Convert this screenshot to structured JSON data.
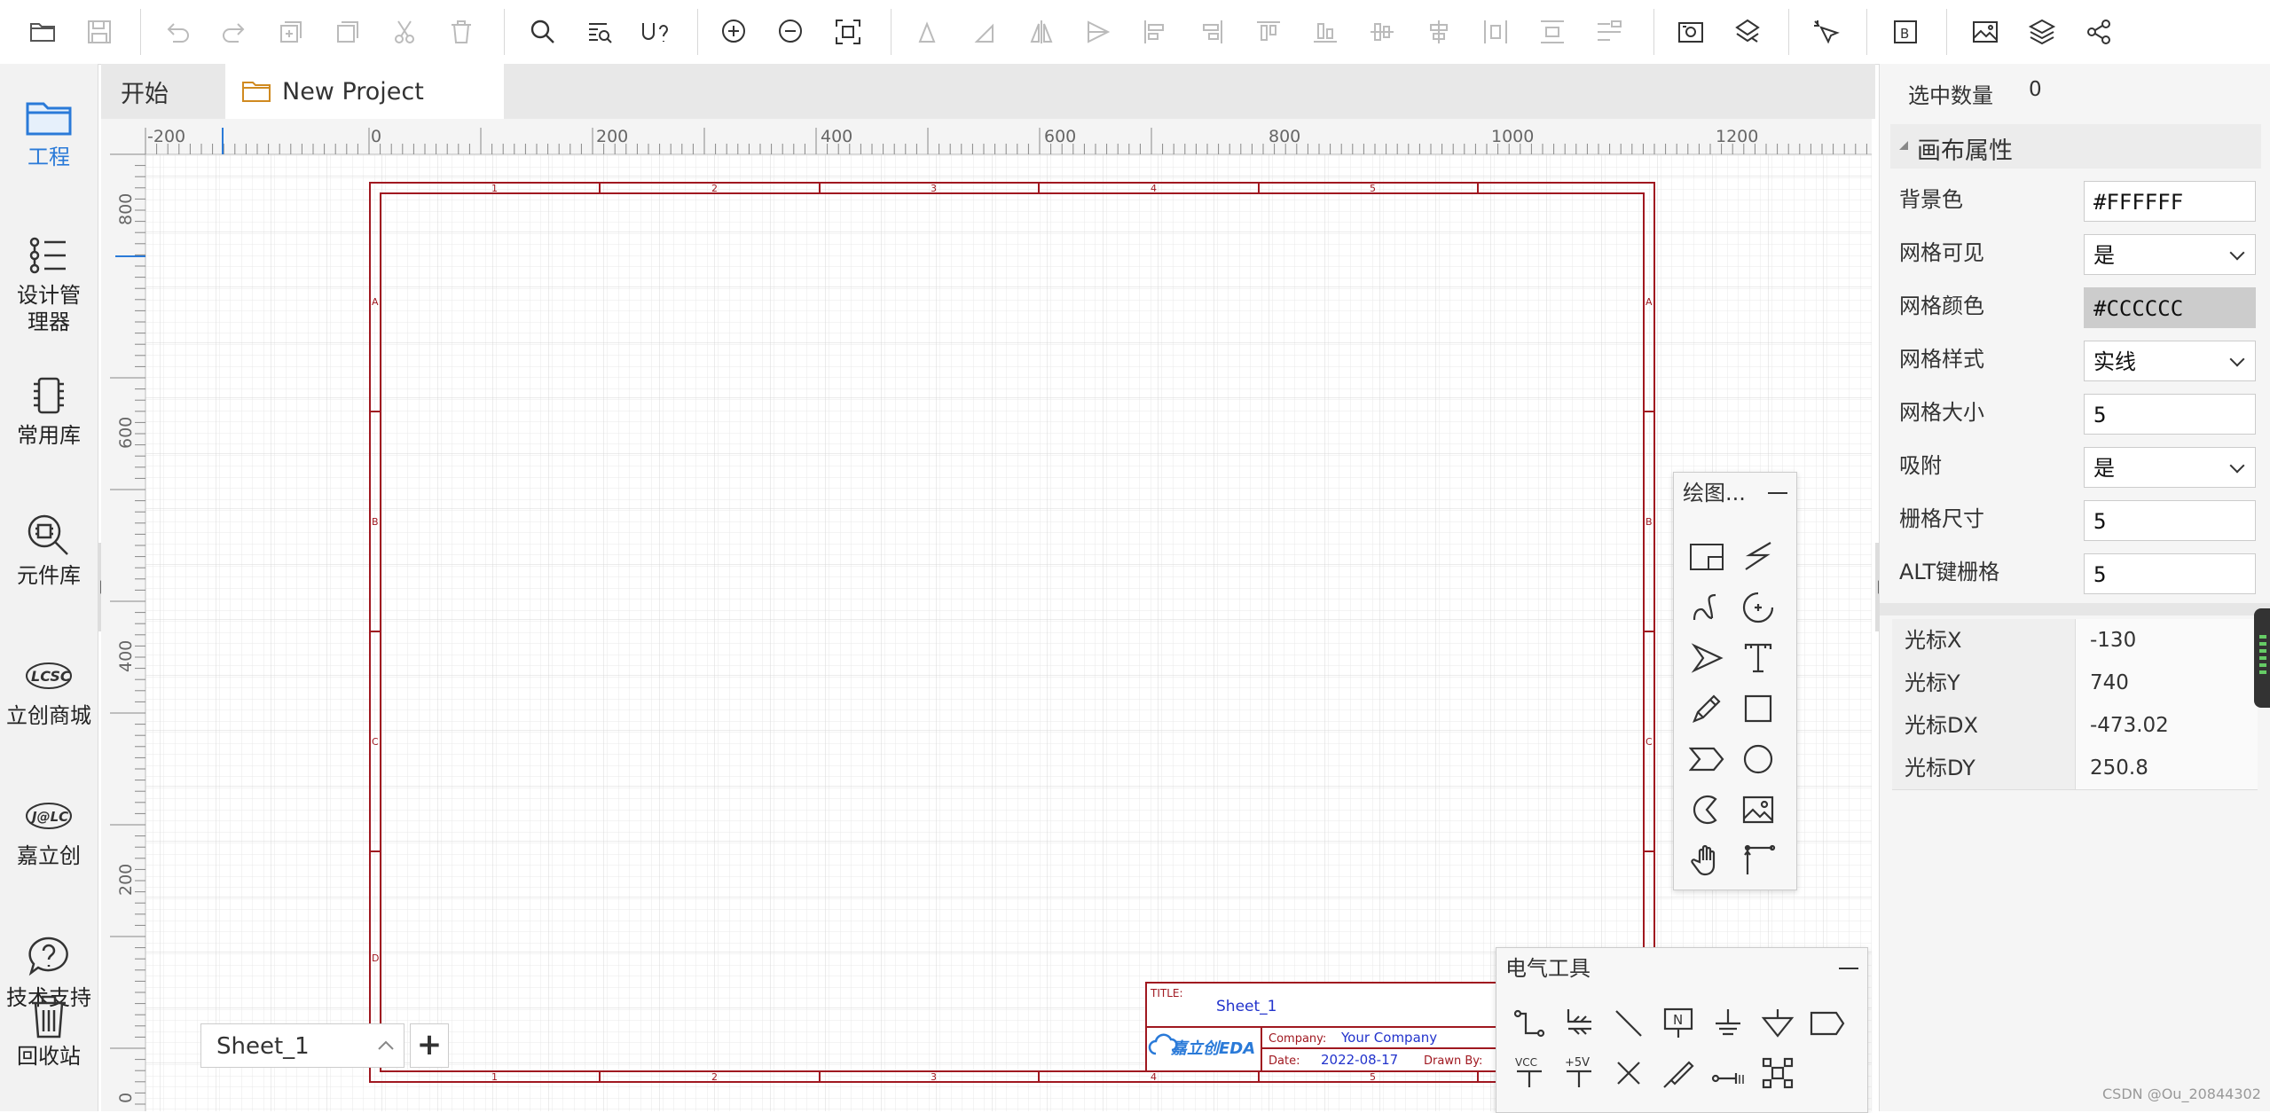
{
  "tabs": {
    "start": "开始",
    "project": "New Project"
  },
  "sidebar": {
    "items": [
      {
        "label": "工程",
        "icon": "folder-icon"
      },
      {
        "label": "设计管理器",
        "icon": "list-icon"
      },
      {
        "label": "常用库",
        "icon": "chip-icon"
      },
      {
        "label": "元件库",
        "icon": "component-search-icon"
      },
      {
        "label": "立创商城",
        "icon": "lcsc-logo-icon"
      },
      {
        "label": "嘉立创",
        "icon": "jlc-logo-icon"
      },
      {
        "label": "技术支持",
        "icon": "help-icon"
      },
      {
        "label": "回收站",
        "icon": "trash-icon"
      }
    ],
    "logo_text": {
      "lcsc": "LCSC",
      "jlc": "J@LC"
    }
  },
  "ruler": {
    "top_labels": [
      "-200",
      "0",
      "200",
      "400",
      "600",
      "800",
      "1000",
      "1200"
    ],
    "left_labels": [
      "800",
      "600",
      "400",
      "200",
      "0"
    ]
  },
  "frame": {
    "col_labels": [
      "1",
      "2",
      "3",
      "4",
      "5"
    ],
    "row_labels": [
      "A",
      "B",
      "C",
      "D"
    ],
    "title_label": "TITLE:",
    "title_value": "Sheet_1",
    "company_label": "Company:",
    "company_value": "Your Company",
    "date_label": "Date:",
    "date_value": "2022-08-17",
    "drawn_label": "Drawn By:",
    "logo": "嘉立创EDA"
  },
  "sheet": {
    "name": "Sheet_1",
    "add": "+"
  },
  "drawing_panel": {
    "title": "绘图...",
    "tools": [
      "image-frame-icon",
      "polyline-icon",
      "bezier-icon",
      "arc-icon",
      "arrowhead-icon",
      "text-icon",
      "freehand-icon",
      "rectangle-icon",
      "polygon-icon",
      "circle-icon",
      "pie-icon",
      "image-icon",
      "pan-icon",
      "dimension-icon"
    ]
  },
  "electric_panel": {
    "title": "电气工具",
    "tools": [
      "wire-icon",
      "bus-icon",
      "line-icon",
      "net-label-icon",
      "ground-icon",
      "pin-ground-icon",
      "net-port-icon"
    ],
    "tools2": [
      "vcc-icon",
      "plus5v-icon",
      "no-connect-icon",
      "probe-icon",
      "pin-icon",
      "select-icon"
    ],
    "vcc": "VCC",
    "plus5v": "+5V",
    "netflag": "N"
  },
  "right_panel": {
    "selected_label": "选中数量",
    "selected_value": "0",
    "section_title": "画布属性",
    "props": [
      {
        "label": "背景色",
        "value": "#FFFFFF",
        "type": "text"
      },
      {
        "label": "网格可见",
        "value": "是",
        "type": "select"
      },
      {
        "label": "网格颜色",
        "value": "#CCCCCC",
        "type": "color"
      },
      {
        "label": "网格样式",
        "value": "实线",
        "type": "select"
      },
      {
        "label": "网格大小",
        "value": "5",
        "type": "text"
      },
      {
        "label": "吸附",
        "value": "是",
        "type": "select"
      },
      {
        "label": "栅格尺寸",
        "value": "5",
        "type": "text"
      },
      {
        "label": "ALT键栅格",
        "value": "5",
        "type": "text"
      }
    ],
    "cursor": [
      {
        "label": "光标X",
        "value": "-130"
      },
      {
        "label": "光标Y",
        "value": "740"
      },
      {
        "label": "光标DX",
        "value": "-473.02"
      },
      {
        "label": "光标DY",
        "value": "250.8"
      }
    ]
  },
  "watermark": "CSDN @Ou_20844302",
  "colors": {
    "frame": "#a01820",
    "grid": "#e6e6e6",
    "accent": "#2a7ad8"
  }
}
